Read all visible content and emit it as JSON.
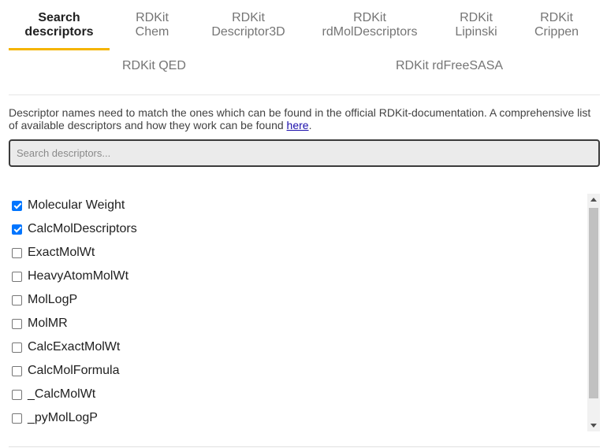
{
  "tabs": {
    "row1": [
      {
        "line1": "Search",
        "line2": "descriptors"
      },
      {
        "line1": "RDKit",
        "line2": "Chem"
      },
      {
        "line1": "RDKit",
        "line2": "Descriptor3D"
      },
      {
        "line1": "RDKit",
        "line2": "rdMolDescriptors"
      },
      {
        "line1": "RDKit",
        "line2": "Lipinski"
      },
      {
        "line1": "RDKit",
        "line2": "Crippen"
      }
    ],
    "row2": [
      {
        "label": "RDKit QED"
      },
      {
        "label": "RDKit rdFreeSASA"
      }
    ],
    "active_index": 0,
    "accent_color": "#f5b400"
  },
  "info": {
    "text": "Descriptor names need to match the ones which can be found in the official RDKit-documentation. A comprehensive list of available descriptors and how they work can be found ",
    "link": "here",
    "suffix": "."
  },
  "search": {
    "placeholder": "Search descriptors...",
    "value": ""
  },
  "descriptors": [
    {
      "label": "Molecular Weight",
      "checked": true
    },
    {
      "label": "CalcMolDescriptors",
      "checked": true
    },
    {
      "label": "ExactMolWt",
      "checked": false
    },
    {
      "label": "HeavyAtomMolWt",
      "checked": false
    },
    {
      "label": "MolLogP",
      "checked": false
    },
    {
      "label": "MolMR",
      "checked": false
    },
    {
      "label": "CalcExactMolWt",
      "checked": false
    },
    {
      "label": "CalcMolFormula",
      "checked": false
    },
    {
      "label": "_CalcMolWt",
      "checked": false
    },
    {
      "label": "_pyMolLogP",
      "checked": false
    }
  ]
}
